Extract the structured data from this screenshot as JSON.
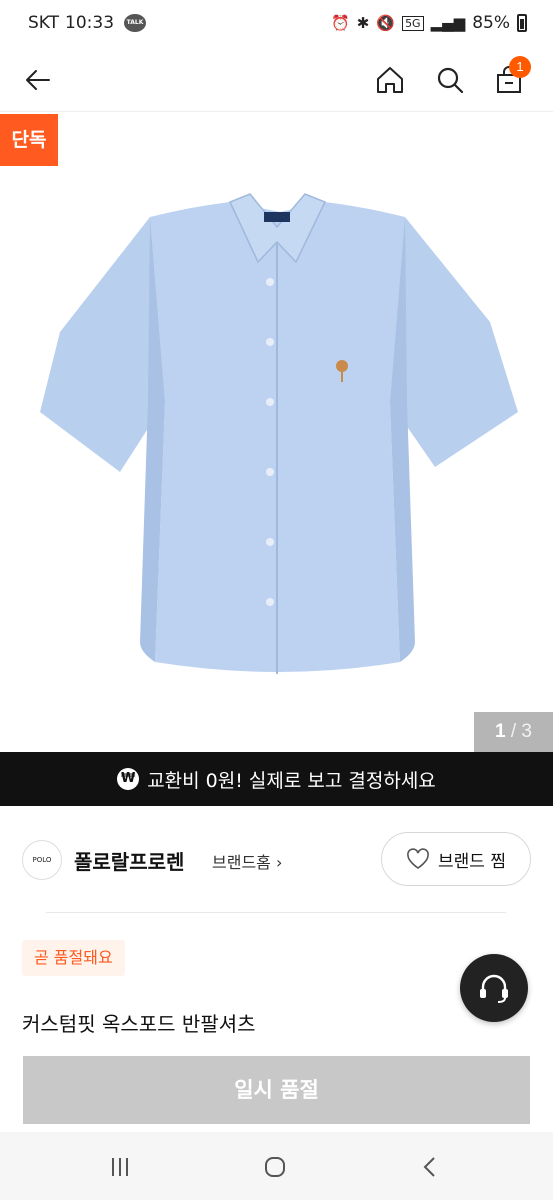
{
  "status_bar": {
    "carrier": "SKT",
    "time": "10:33",
    "talk_badge": "TALK",
    "network": "5G",
    "battery": "85%"
  },
  "header": {
    "cart_count": "1"
  },
  "product_image": {
    "exclusive_tag": "단독",
    "pager_current": "1",
    "pager_separator": " / ",
    "pager_total": "3"
  },
  "banner": {
    "icon_text": "₩",
    "text": "교환비 0원! 실제로 보고 결정하세요"
  },
  "brand": {
    "logo_text": "POLO",
    "name": "폴로랄프로렌",
    "home_link": "브랜드홈",
    "favorite_label": "브랜드 찜"
  },
  "product": {
    "sold_soon_badge": "곧 품절돼요",
    "title": "커스텀핏 옥스포드 반팔셔츠",
    "buy_button": "일시 품절"
  },
  "colors": {
    "accent": "#ff5a1f",
    "banner_bg": "#111111",
    "disabled_button": "#c8c8c8",
    "shirt": "#b9cfee"
  }
}
